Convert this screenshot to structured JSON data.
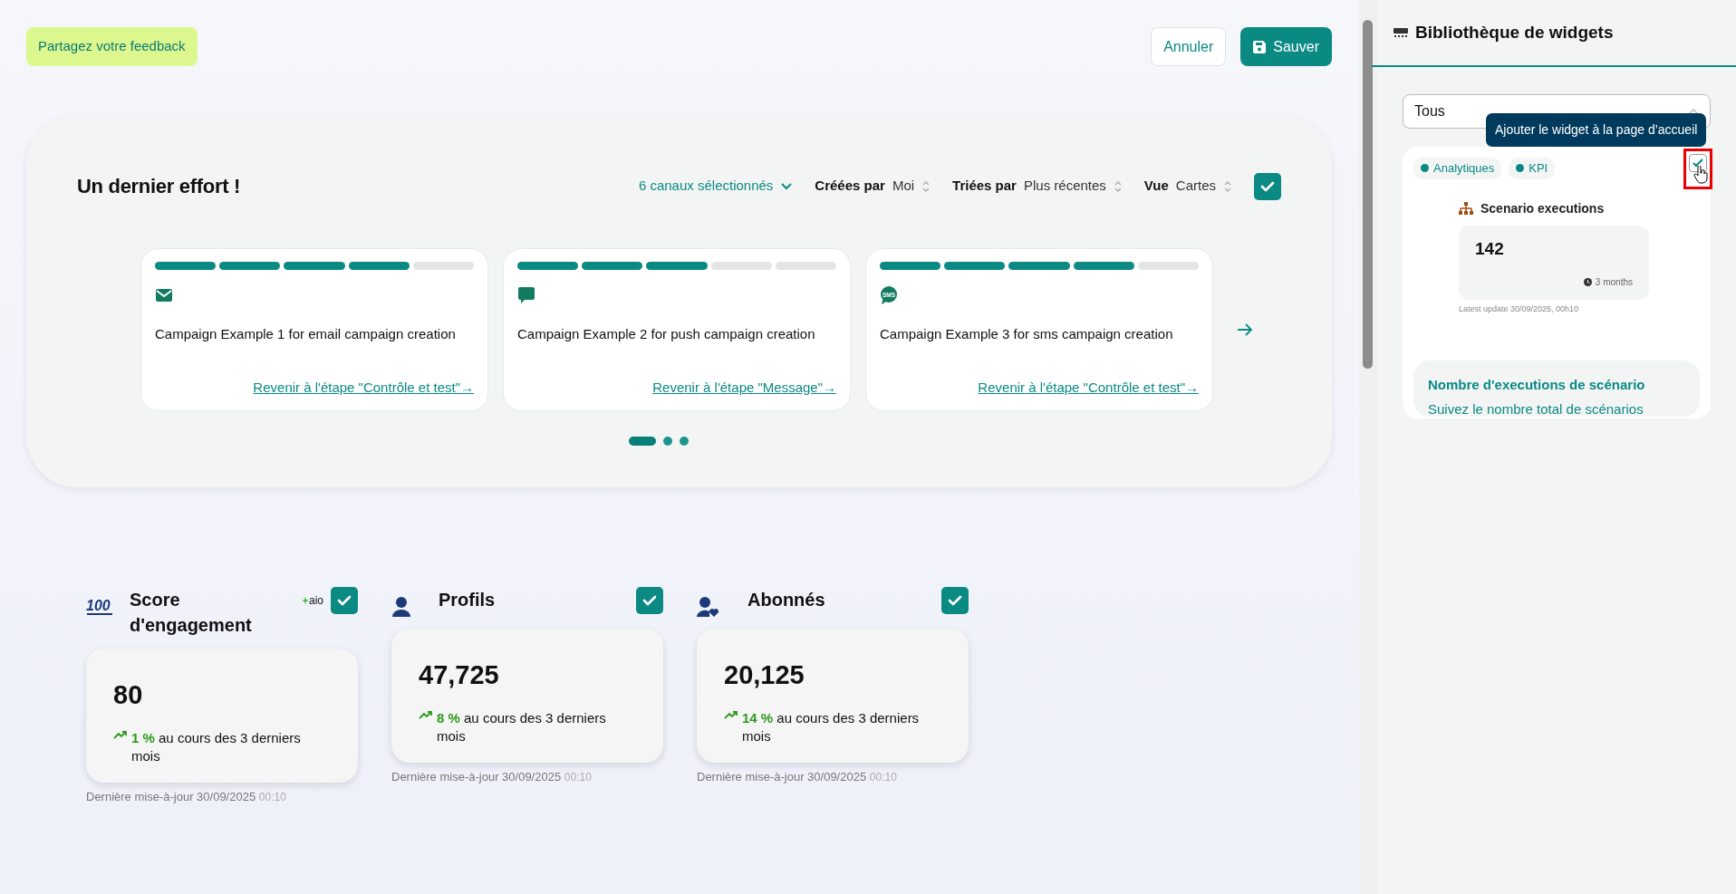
{
  "header": {
    "feedback_button": "Partagez votre feedback",
    "cancel_button": "Annuler",
    "save_button": "Sauver"
  },
  "onboarding": {
    "title": "Un dernier effort !",
    "channels_filter": "6 canaux sélectionnés",
    "checked": true,
    "filters": [
      {
        "label": "Créées par",
        "value": "Moi"
      },
      {
        "label": "Triées par",
        "value": "Plus récentes"
      },
      {
        "label": "Vue",
        "value": "Cartes"
      }
    ],
    "campaigns": [
      {
        "kind": "email",
        "level": 0.8,
        "name": "Campaign Example 1 for email campaign creation",
        "link": "Revenir à l'étape \"Contrôle et test\"→"
      },
      {
        "kind": "push",
        "level": 0.6,
        "name": "Campaign Example 2 for push campaign creation",
        "link": "Revenir à l'étape \"Message\"→"
      },
      {
        "kind": "sms",
        "icon_text": "SMS",
        "level": 0.8,
        "name": "Campaign Example 3 for sms campaign creation",
        "link": "Revenir à l'étape \"Contrôle et test\"→"
      }
    ],
    "pages": [
      {
        "selected": true
      },
      {
        "selected": false
      },
      {
        "selected": false
      }
    ]
  },
  "kpis": [
    {
      "kind": "score",
      "icon_text": "100",
      "title": "Score d'engagement",
      "badge": "aio",
      "checked": true,
      "value": "80",
      "trend": "1 %",
      "trend_text": "au cours des 3 derniers mois",
      "updated": "Dernière mise-à-jour 30/09/2025",
      "time": "00:10"
    },
    {
      "kind": "profiles",
      "title": "Profils",
      "checked": true,
      "value": "47,725",
      "trend": "8 %",
      "trend_text": "au cours des 3 derniers mois",
      "updated": "Dernière mise-à-jour 30/09/2025",
      "time": "00:10"
    },
    {
      "kind": "subscribers",
      "title": "Abonnés",
      "checked": true,
      "value": "20,125",
      "trend": "14 %",
      "trend_text": "au cours des 3 derniers mois",
      "updated": "Dernière mise-à-jour 30/09/2025",
      "time": "00:10"
    }
  ],
  "library": {
    "title": "Bibliothèque de widgets",
    "filter": "Tous",
    "tooltip": "Ajouter le widget à la page d’accueil",
    "widget": {
      "tags": [
        "Analytiques",
        "KPI"
      ],
      "checked": true,
      "preview": {
        "title": "Scenario executions",
        "value": "142",
        "period": "3 months",
        "updated": "Latest update 30/09/2025, 00h10"
      },
      "name": "Nombre d'executions de scénario",
      "description": "Suivez le nombre total de scénarios"
    }
  }
}
